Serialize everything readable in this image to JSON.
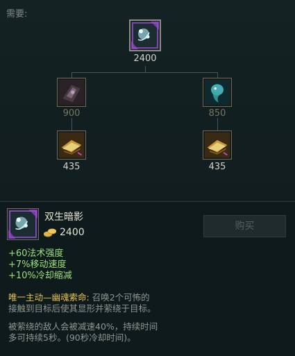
{
  "header": {
    "needs_label": "需要:"
  },
  "tree": {
    "root": {
      "icon": "twin-shadows-icon",
      "cost": "2400"
    },
    "left": {
      "icon": "dark-tome-icon",
      "cost": "900"
    },
    "right": {
      "icon": "spectral-ghost-icon",
      "cost": "850"
    },
    "left_child": {
      "icon": "golden-tome-icon",
      "cost": "435"
    },
    "right_child": {
      "icon": "golden-tome-icon",
      "cost": "435"
    }
  },
  "detail": {
    "icon": "twin-shadows-icon",
    "name": "双生暗影",
    "gold_icon": "gold-coins-icon",
    "price": "2400",
    "buy_label": "购买"
  },
  "stats": [
    "+60法术强度",
    "+7%移动速度",
    "+10%冷却缩减"
  ],
  "description": {
    "unique_label": "唯一主动—幽魂索命:",
    "line1_rest": " 召唤2个可怖的",
    "line2": "接触到目标后使其显形并萦绕于目标。",
    "para2_line1": "被萦绕的敌人会被减速40%，持续时间",
    "para2_line2": "多可持续5秒。(90秒冷却时间)。"
  },
  "colors": {
    "stat_green": "#9ce07c",
    "unique_gold": "#e8c450",
    "background": "#0e1a1c"
  }
}
